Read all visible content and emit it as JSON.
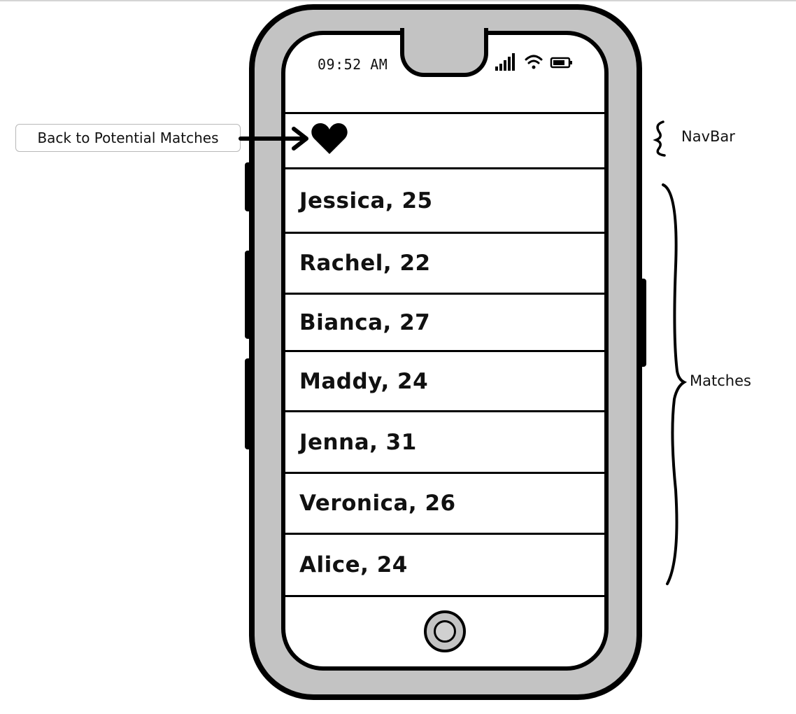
{
  "status_bar": {
    "time": "09:52 AM",
    "icons": [
      "signal-icon",
      "wifi-icon",
      "battery-icon"
    ]
  },
  "navbar": {
    "icon": "heart-icon"
  },
  "matches": [
    {
      "label": "Jessica, 25"
    },
    {
      "label": "Rachel, 22"
    },
    {
      "label": "Bianca, 27"
    },
    {
      "label": "Maddy, 24"
    },
    {
      "label": "Jenna, 31"
    },
    {
      "label": "Veronica, 26"
    },
    {
      "label": "Alice, 24"
    }
  ],
  "annotations": {
    "back_callout": "Back to Potential Matches",
    "navbar_label": "NavBar",
    "matches_label": "Matches"
  },
  "colors": {
    "device_body": "#c3c3c3",
    "ink": "#000000",
    "screen": "#ffffff"
  }
}
